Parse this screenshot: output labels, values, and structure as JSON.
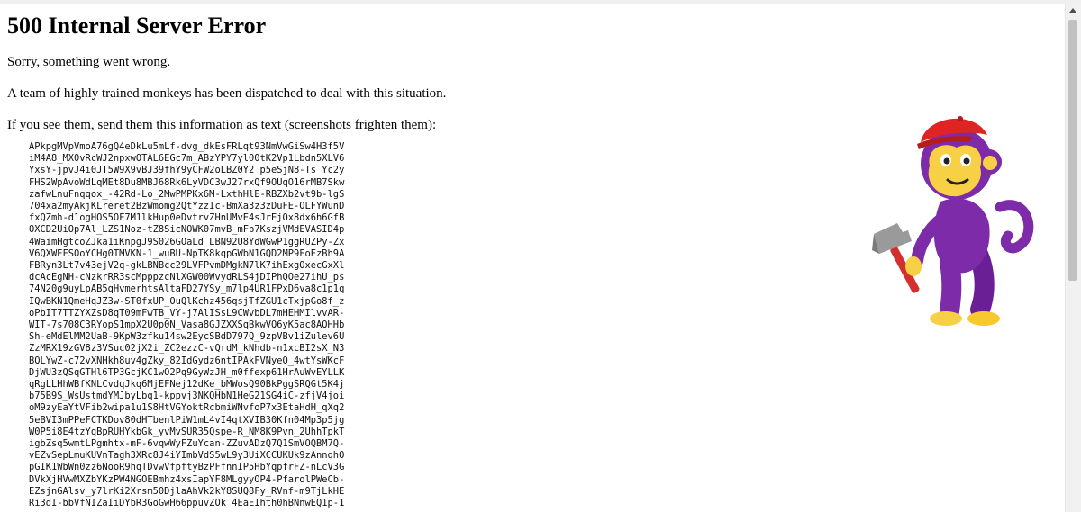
{
  "error": {
    "title": "500 Internal Server Error",
    "messages": [
      "Sorry, something went wrong.",
      "A team of highly trained monkeys has been dispatched to deal with this situation.",
      "If you see them, send them this information as text (screenshots frighten them):"
    ],
    "info_text": "APkpgMVpVmoA76gQ4eDkLu5mLf-dvg_dkEsFRLqt93NmVwGiSw4H3f5V\niM4A8_MX0vRcWJ2npxwOTAL6EGc7m_ABzYPY7yl00tK2Vp1Lbdn5XLV6\nYxsY-jpvJ4i0JT5W9X9vBJ39fhY9yCFW2oLBZ0Y2_p5eSjN8-Ts_Yc2y\nFHS2WpAvoWdLqMEt8Du8MBJ68Rk6LyVDC3wJ27rxQf9OUqO16rMB7Skw\nzafwLnuFnqqox_-42Rd-Lo_2MwPMPKx6M-LxthHlE-RBZXb2vt9b-lgS\n704xa2myAkjKLreret2BzWmomg2QtYzzIc-BmXa3z3zDuFE-OLFYWunD\nfxQZmh-d1ogHOS5OF7M1lkHup0eDvtrvZHnUMvE4sJrEjOx8dx6h6GfB\nOXCD2UiOp7Al_LZS1Noz-tZ8SicNOWK07mvB_mFb7KszjVMdEVASID4p\n4WaimHgtcoZJka1iKnpgJ9S026GOaLd_LBN92U8YdWGwP1ggRUZPy-Zx\nV6QXWEFSOoYCHg0TMVKN-1_wuBU-NpTK8kqpGWbN1GQD2MP9FoEzBh9A\nFBRyn3Lt7v43ejV2q-gkLBNBcc29LVFPvmDMgkN7lK7ihExgOxecGxXl\ndcAcEgNH-cNzkrRR3scMpppzcNlXGW00WvydRLS4jDIPhQOe27ihU_ps\n74N20g9uyLpAB5qHvmerhtsAltaFD27YSy_m7lp4UR1FPxD6va8c1p1q\nIQwBKN1QmeHqJZ3w-ST0fxUP_OuQlKchz456qsjTfZGU1cTxjpGo8f_z\noPbIT7TTZYXZsD8qT09mFwTB_VY-j7AlISsL9CWvbDL7mHEHMIlvvAR-\nWIT-7s708C3RYopS1mpX2U0p0N_Vasa8GJZXXSqBkwVQ6yK5ac8AQHHb\nSh-eMdElMM2UaB-9KpW3zfku14sw2EycSBdD797Q_9zpVBv1iZulev6U\nZzMRX19zGV8z3VSuc02jX2i_ZC2ezzC-vQrdM_kNhdb-n1xcBI2sX_N3\nBQLYwZ-c72vXNHkh8uv4gZky_82IdGydz6ntIPAkFVNyeQ_4wtYsWKcF\nDjWU3zQSqGTHl6TP3GcjKC1wO2Pq9GyWzJH_m0ffexp61HrAuWvEYLLK\nqRgLLHhWBfKNLCvdqJkq6MjEFNej12dKe_bMWosQ90BkPggSRQGt5K4j\nb75B9S_WsUstmdYMJbyLbq1-kppvj3NKQHbN1HeG21SG4iC-zfjV4joi\noM9zyEaYtVFib2wipa1u1S8HtVGYoktRcbmiWNvfoP7x3EtaHdH_qXq2\n5eBVI3mPPeFCTKDov80dHTbenlPiW1mL4vI4qtXVIB30Kfn04Mp3p5jg\nW0P5i8E4tzYqBpRUHYkbGk_yvMvSUR35Qspe-R_NM8K9Pvn_2UhhTpkT\nigbZsq5wmtLPgmhtx-mF-6vqwWyFZuYcan-ZZuvADzQ7Q1SmVOQBM7Q-\nvEZvSepLmuKUVnTagh3XRc8J4iYImbVdS5wL9y3UiXCCUKUk9zAnnqhO\npGIK1WbWn0zz6NooR9hqTDvwVfpftyBzPFfnnIP5HbYqpfrFZ-nLcV3G\nDVkXjHVwMXZbYKzPW4NGOEBmhz4xsIapYF8MLgyyOP4-PfarolPWeCb-\nEZsjnGAlsv_y7lrKi2Xrsm50DjlaAhVk2kY8SUQ8Fy_RVnf-m9TjLkHE\nRi3dI-bbVfNIZaIiDYbR3GoGwH66ppuvZOk_4EaEIhth0hBNnwEQ1p-1"
  },
  "illustration": {
    "icon": "monkey-with-hammer-icon",
    "colors": {
      "fur": "#7d2ba8",
      "face": "#f7d046",
      "cap": "#e02424",
      "hammer_head": "#8f8f8f",
      "hammer_handle": "#d32f2f"
    }
  }
}
